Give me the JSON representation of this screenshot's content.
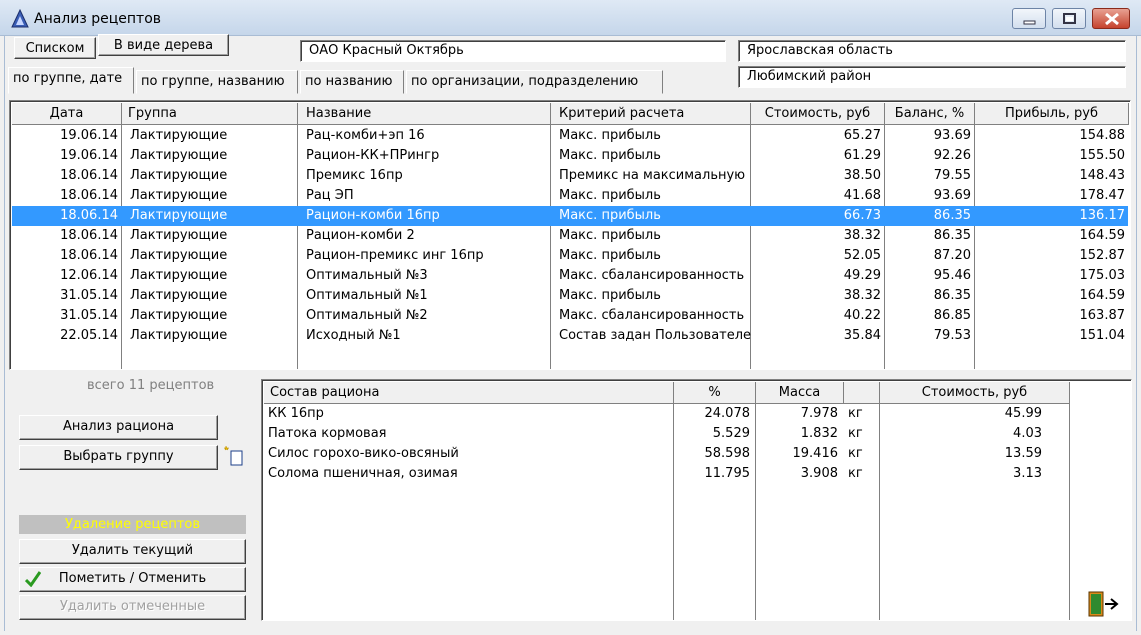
{
  "window": {
    "title": "Анализ рецептов"
  },
  "view_buttons": {
    "list": "Списком",
    "tree": "В виде дерева"
  },
  "org": {
    "name": "ОАО Красный Октябрь",
    "region": "Ярославская область",
    "district": "Любимский район"
  },
  "tabs": [
    "по группе, дате",
    "по группе, названию",
    "по названию",
    "по организации, подразделению"
  ],
  "recipes": {
    "columns": [
      "Дата",
      "Группа",
      "Название",
      "Критерий расчета",
      "Стоимость, руб",
      "Баланс, %",
      "Прибыль, руб"
    ],
    "rows": [
      [
        "19.06.14",
        "Лактирующие",
        "Рац-комби+эп 16",
        "Макс. прибыль",
        "65.27",
        "93.69",
        "154.88"
      ],
      [
        "19.06.14",
        "Лактирующие",
        "Рацион-КК+ПРингр",
        "Макс. прибыль",
        "61.29",
        "92.26",
        "155.50"
      ],
      [
        "18.06.14",
        "Лактирующие",
        "Премикс 16пр",
        "Премикс на максимальную",
        "38.50",
        "79.55",
        "148.43"
      ],
      [
        "18.06.14",
        "Лактирующие",
        "Рац ЭП",
        "Макс. прибыль",
        "41.68",
        "93.69",
        "178.47"
      ],
      [
        "18.06.14",
        "Лактирующие",
        "Рацион-комби 16пр",
        "Макс. прибыль",
        "66.73",
        "86.35",
        "136.17"
      ],
      [
        "18.06.14",
        "Лактирующие",
        "Рацион-комби 2",
        "Макс. прибыль",
        "38.32",
        "86.35",
        "164.59"
      ],
      [
        "18.06.14",
        "Лактирующие",
        "Рацион-премикс инг 16пр",
        "Макс. прибыль",
        "52.05",
        "87.20",
        "152.87"
      ],
      [
        "12.06.14",
        "Лактирующие",
        "Оптимальный №3",
        "Макс. сбалансированность",
        "49.29",
        "95.46",
        "175.03"
      ],
      [
        "31.05.14",
        "Лактирующие",
        " Оптимальный №1",
        "Макс. прибыль",
        "38.32",
        "86.35",
        "164.59"
      ],
      [
        "31.05.14",
        "Лактирующие",
        "Оптимальный №2",
        "Макс. сбалансированность",
        "40.22",
        "86.85",
        "163.87"
      ],
      [
        "22.05.14",
        "Лактирующие",
        "Исходный №1",
        "Состав задан Пользователем",
        "35.84",
        "79.53",
        "151.04"
      ]
    ],
    "selected_index": 4,
    "total_label": "всего 11 рецептов"
  },
  "actions": {
    "analyze": "Анализ рациона",
    "choose_group": "Выбрать группу",
    "delete_section": "Удаление рецептов",
    "delete_current": "Удалить текущий",
    "mark_toggle": "Пометить / Отменить",
    "delete_marked": "Удалить отмеченные"
  },
  "composition": {
    "columns": [
      "Состав рациона",
      "%",
      "Масса",
      "Стоимость, руб"
    ],
    "rows": [
      [
        "КК 16пр",
        "24.078",
        "7.978",
        "кг",
        "45.99"
      ],
      [
        "Патока кормовая",
        "5.529",
        "1.832",
        "кг",
        "4.03"
      ],
      [
        "Силос горохо-вико-овсяный",
        "58.598",
        "19.416",
        "кг",
        "13.59"
      ],
      [
        "Солома пшеничная, озимая",
        "11.795",
        "3.908",
        "кг",
        "3.13"
      ]
    ]
  },
  "colors": {
    "selection": "#3399ff",
    "delete_header_bg": "#c0c0c0",
    "delete_header_text": "#ffff00"
  }
}
